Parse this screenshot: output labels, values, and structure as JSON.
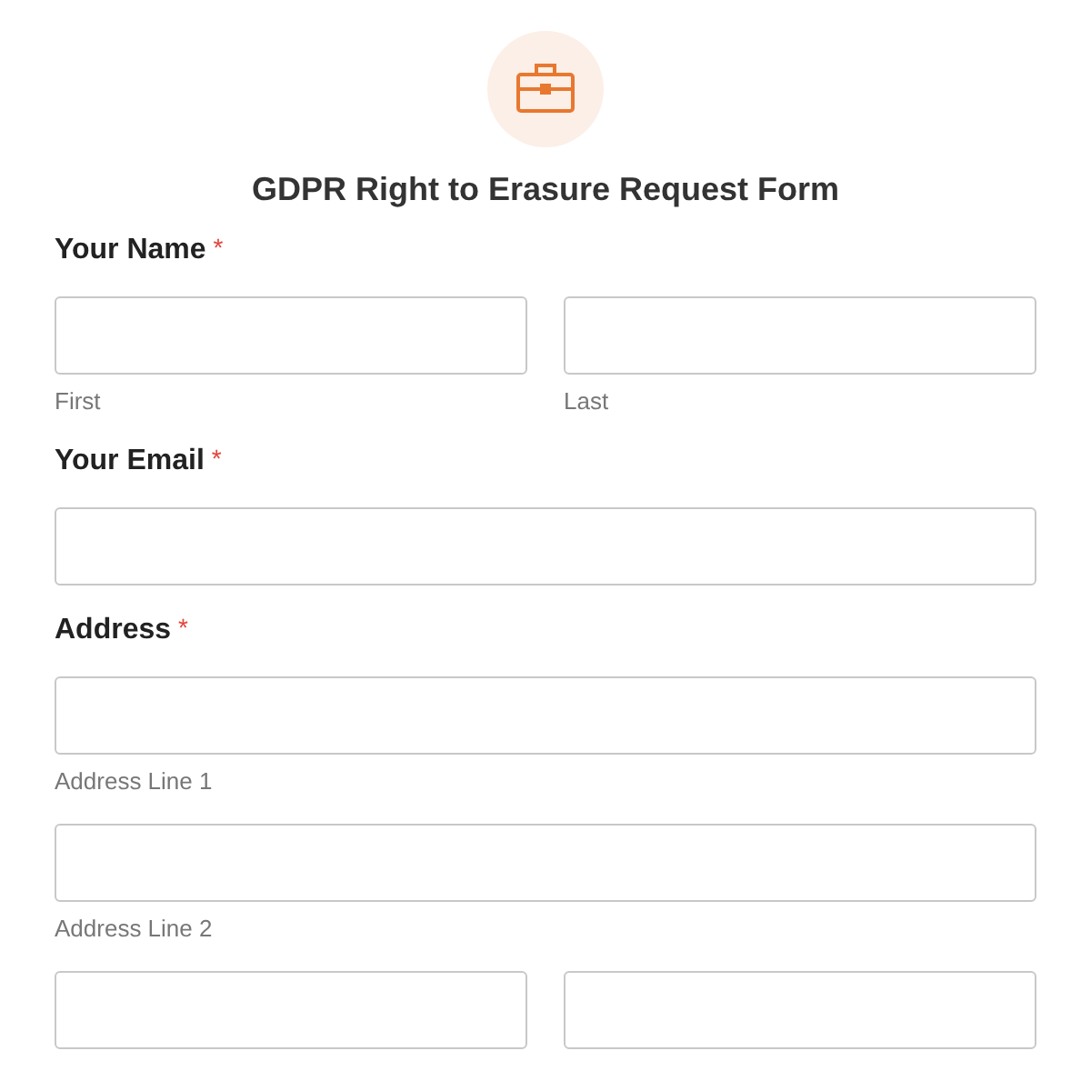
{
  "title": "GDPR Right to Erasure Request Form",
  "groups": [
    {
      "label": "Your Name",
      "required_mark": "*",
      "rows": [
        [
          {
            "sublabel": "First"
          },
          {
            "sublabel": "Last"
          }
        ]
      ]
    },
    {
      "label": "Your Email",
      "required_mark": "*",
      "rows": [
        [
          {}
        ]
      ]
    },
    {
      "label": "Address",
      "required_mark": "*",
      "rows": [
        [
          {
            "sublabel": "Address Line 1"
          }
        ],
        [
          {
            "sublabel": "Address Line 2"
          }
        ],
        [
          {},
          {}
        ]
      ]
    }
  ]
}
